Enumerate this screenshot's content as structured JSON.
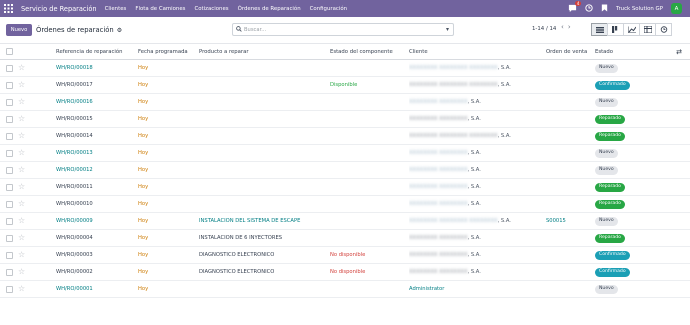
{
  "navbar": {
    "app_name": "Servicio de Reparación",
    "menu": [
      "Clientes",
      "Flota de Camiones",
      "Cotizaciones",
      "Órdenes de Reparación",
      "Configuración"
    ],
    "chat_count": "4",
    "company": "Truck Solution GP",
    "avatar_letter": "A",
    "colors": {
      "bar": "#71639e",
      "avatar": "#28a745"
    }
  },
  "control": {
    "new_label": "Nuevo",
    "title": "Órdenes de reparación",
    "search_placeholder": "Buscar...",
    "pager": "1-14 / 14"
  },
  "table": {
    "headers": {
      "ref": "Referencia de reparación",
      "date": "Fecha programada",
      "product": "Producto a reparar",
      "component": "Estado del componente",
      "client": "Cliente",
      "order": "Orden de venta",
      "state": "Estado"
    },
    "rows": [
      {
        "ref": "WH/RO/00018",
        "ref_link": true,
        "date": "Hoy",
        "product": "",
        "product_link": false,
        "component": "",
        "comp_type": "",
        "client_a": "XXXXXXXX XXXXXXXX XXXXXXXX",
        "client_b": ", S.A.",
        "client_dark": false,
        "client_link": false,
        "order": "",
        "state": "Nuevo",
        "state_type": "nuevo"
      },
      {
        "ref": "WH/RO/00017",
        "ref_link": false,
        "date": "Hoy",
        "product": "",
        "product_link": false,
        "component": "Disponible",
        "comp_type": "disp",
        "client_a": "XXXXXXXX XXXXXXXX XXXXXXXX",
        "client_b": ", S.A.",
        "client_dark": true,
        "client_link": false,
        "order": "",
        "state": "Confirmado",
        "state_type": "confirmado"
      },
      {
        "ref": "WH/RO/00016",
        "ref_link": true,
        "date": "Hoy",
        "product": "",
        "product_link": false,
        "component": "",
        "comp_type": "",
        "client_a": "XXXXXXXX XXXXXXXX",
        "client_b": ", S.A.",
        "client_dark": false,
        "client_link": false,
        "order": "",
        "state": "Nuevo",
        "state_type": "nuevo"
      },
      {
        "ref": "WH/RO/00015",
        "ref_link": false,
        "date": "Hoy",
        "product": "",
        "product_link": false,
        "component": "",
        "comp_type": "",
        "client_a": "XXXXXXXX XXXXXXXX",
        "client_b": ", S.A.",
        "client_dark": true,
        "client_link": false,
        "order": "",
        "state": "Reparado",
        "state_type": "reparado"
      },
      {
        "ref": "WH/RO/00014",
        "ref_link": false,
        "date": "Hoy",
        "product": "",
        "product_link": false,
        "component": "",
        "comp_type": "",
        "client_a": "XXXXXXXX XXXXXXXX XXXXXXXX",
        "client_b": ", S.A.",
        "client_dark": true,
        "client_link": false,
        "order": "",
        "state": "Reparado",
        "state_type": "reparado"
      },
      {
        "ref": "WH/RO/00013",
        "ref_link": true,
        "date": "Hoy",
        "product": "",
        "product_link": false,
        "component": "",
        "comp_type": "",
        "client_a": "XXXXXXXX XXXXXXXX",
        "client_b": ", S.A.",
        "client_dark": false,
        "client_link": false,
        "order": "",
        "state": "Nuevo",
        "state_type": "nuevo"
      },
      {
        "ref": "WH/RO/00012",
        "ref_link": true,
        "date": "Hoy",
        "product": "",
        "product_link": false,
        "component": "",
        "comp_type": "",
        "client_a": "XXXXXXXX XXXXXXXX",
        "client_b": ", S.A.",
        "client_dark": false,
        "client_link": false,
        "order": "",
        "state": "Nuevo",
        "state_type": "nuevo"
      },
      {
        "ref": "WH/RO/00011",
        "ref_link": false,
        "date": "Hoy",
        "product": "",
        "product_link": false,
        "component": "",
        "comp_type": "",
        "client_a": "XXXXXXXX XXXXXXXX",
        "client_b": ", S.A.",
        "client_dark": false,
        "client_link": false,
        "order": "",
        "state": "Reparado",
        "state_type": "reparado"
      },
      {
        "ref": "WH/RO/00010",
        "ref_link": false,
        "date": "Hoy",
        "product": "",
        "product_link": false,
        "component": "",
        "comp_type": "",
        "client_a": "XXXXXXXX XXXXXXXX",
        "client_b": ", S.A.",
        "client_dark": false,
        "client_link": false,
        "order": "",
        "state": "Reparado",
        "state_type": "reparado"
      },
      {
        "ref": "WH/RO/00009",
        "ref_link": true,
        "date": "Hoy",
        "product": "INSTALACION DEL SISTEMA DE ESCAPE",
        "product_link": true,
        "component": "",
        "comp_type": "",
        "client_a": "XXXXXXXX XXXXXXXX XXXXXXXX",
        "client_b": ", S.A.",
        "client_dark": false,
        "client_link": false,
        "order": "S00015",
        "state": "Nuevo",
        "state_type": "nuevo"
      },
      {
        "ref": "WH/RO/00004",
        "ref_link": false,
        "date": "Hoy",
        "product": "INSTALACION DE 6 INYECTORES",
        "product_link": false,
        "component": "",
        "comp_type": "",
        "client_a": "XXXXXXXX XXXXXXXX",
        "client_b": ", S.A.",
        "client_dark": true,
        "client_link": false,
        "order": "",
        "state": "Reparado",
        "state_type": "reparado"
      },
      {
        "ref": "WH/RO/00003",
        "ref_link": false,
        "date": "Hoy",
        "product": "DIAGNOSTICO ELECTRONICO",
        "product_link": false,
        "component": "No disponible",
        "comp_type": "nodisp",
        "client_a": "XXXXXXXX XXXXXXXX",
        "client_b": ", S.A.",
        "client_dark": true,
        "client_link": false,
        "order": "",
        "state": "Confirmado",
        "state_type": "confirmado"
      },
      {
        "ref": "WH/RO/00002",
        "ref_link": false,
        "date": "Hoy",
        "product": "DIAGNOSTICO ELECTRONICO",
        "product_link": false,
        "component": "No disponible",
        "comp_type": "nodisp",
        "client_a": "XXXXXXXX XXXXXXXX",
        "client_b": ", S.A.",
        "client_dark": true,
        "client_link": false,
        "order": "",
        "state": "Confirmado",
        "state_type": "confirmado"
      },
      {
        "ref": "WH/RO/00001",
        "ref_link": true,
        "date": "Hoy",
        "product": "",
        "product_link": false,
        "component": "",
        "comp_type": "",
        "client_a": "",
        "client_b": "Administrator",
        "client_dark": false,
        "client_link": true,
        "order": "",
        "state": "Nuevo",
        "state_type": "nuevo"
      }
    ]
  }
}
